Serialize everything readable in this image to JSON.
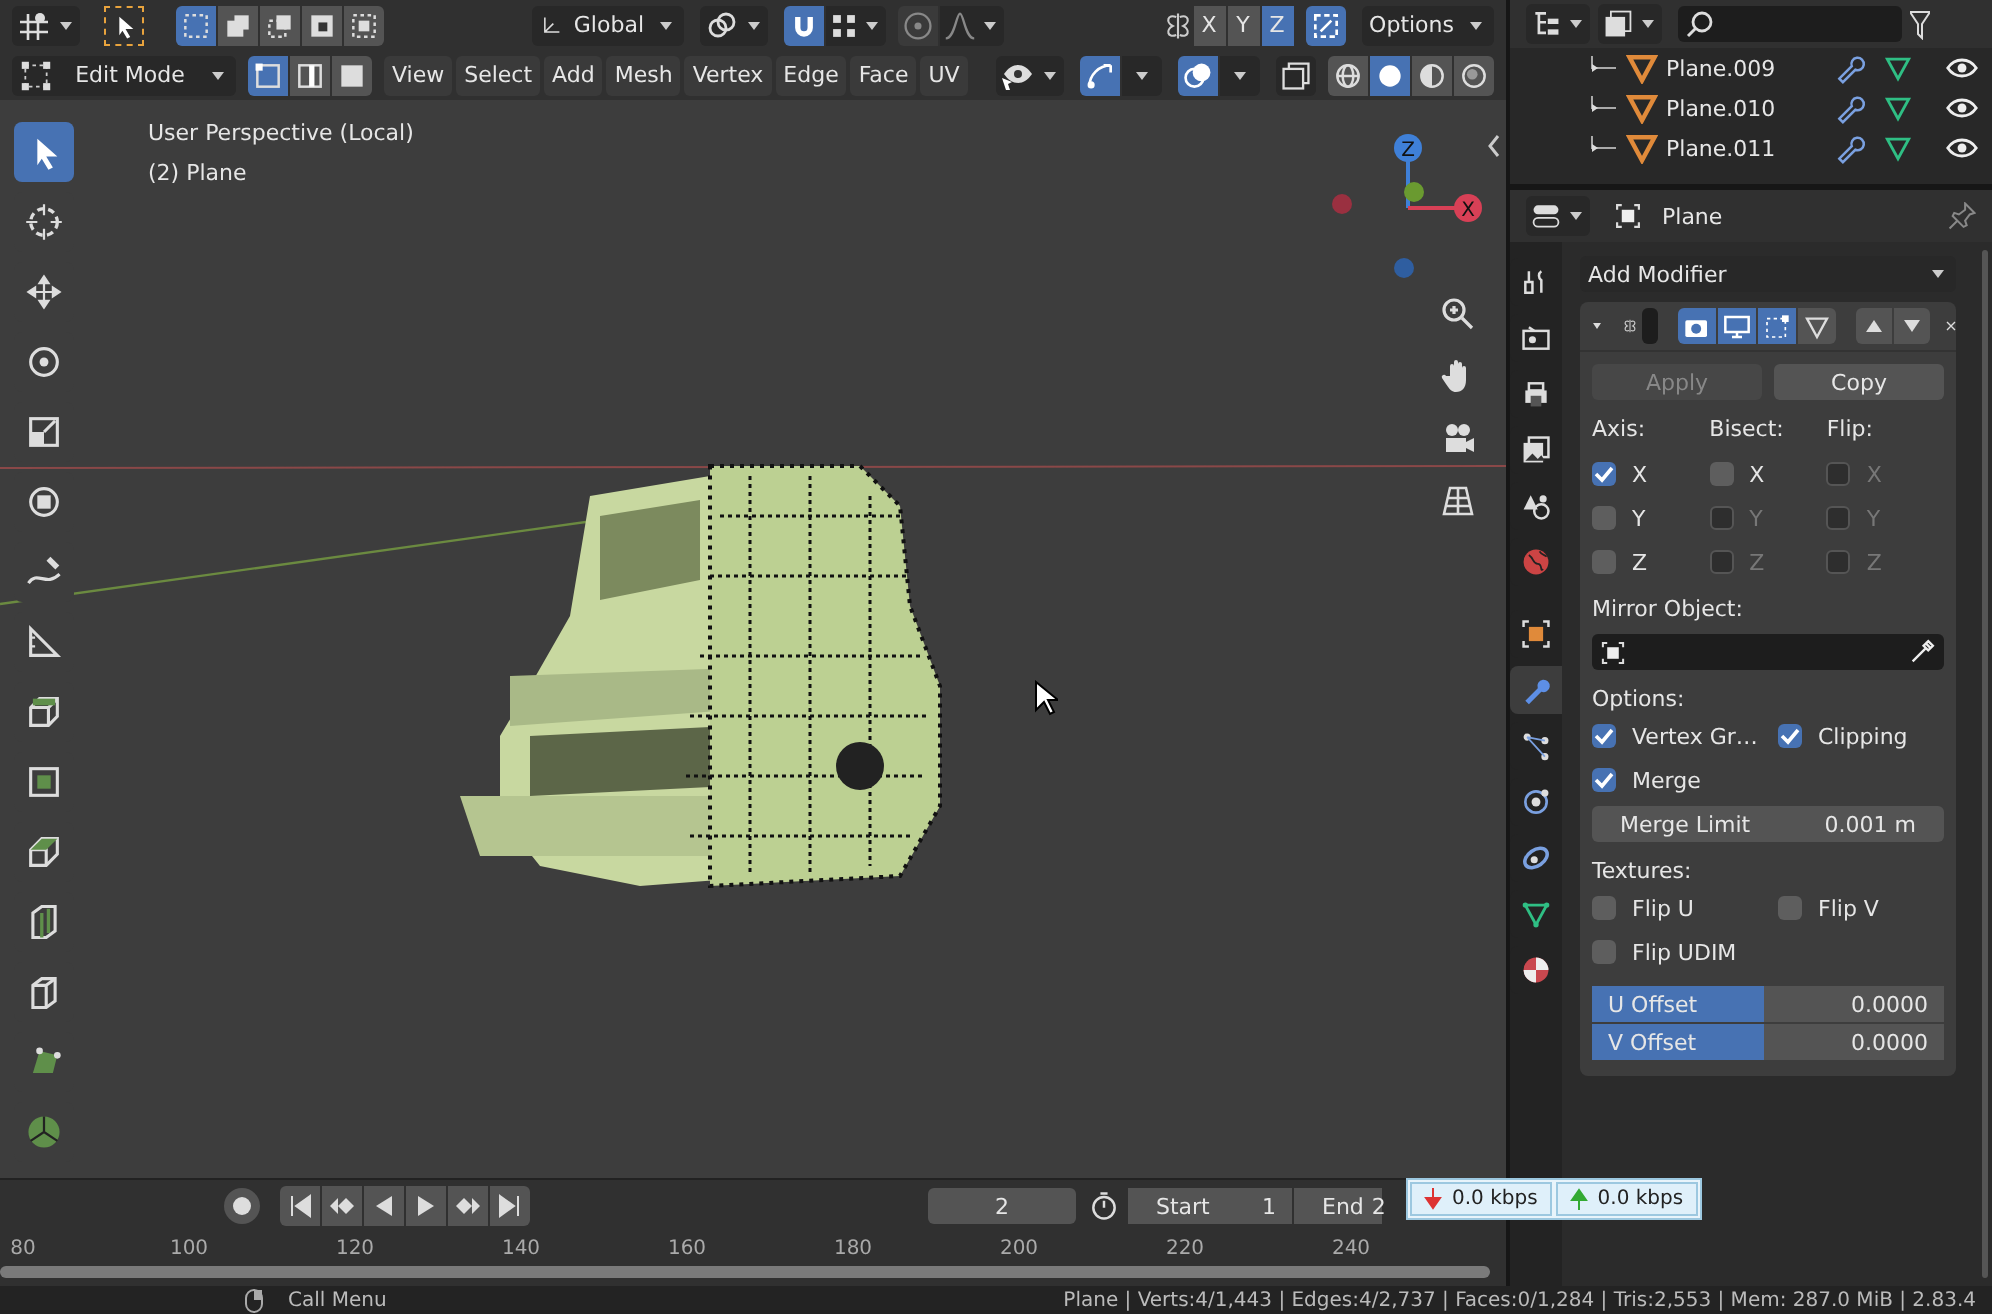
{
  "header": {
    "select_modes": [
      {
        "selected": true
      },
      {
        "selected": false
      },
      {
        "selected": false
      },
      {
        "selected": false
      },
      {
        "selected": false
      }
    ],
    "orientation": "Global",
    "snap_on": true,
    "proportional_on": false,
    "mirror_axes": [
      {
        "label": "X",
        "selected": false
      },
      {
        "label": "Y",
        "selected": false
      },
      {
        "label": "Z",
        "selected": true
      }
    ],
    "gizmo_on": true,
    "options": "Options"
  },
  "mode_bar": {
    "mode": "Edit Mode",
    "element_modes": [
      {
        "selected": true
      },
      {
        "selected": false
      },
      {
        "selected": false
      }
    ],
    "menus": [
      "View",
      "Select",
      "Add",
      "Mesh",
      "Vertex",
      "Edge",
      "Face",
      "UV"
    ],
    "gizmos_on": true,
    "overlays_on": true,
    "xray_on": false,
    "shading": [
      {
        "selected": false
      },
      {
        "selected": true
      },
      {
        "selected": false
      },
      {
        "selected": false
      }
    ]
  },
  "viewport": {
    "view_name": "User Perspective (Local)",
    "object_label": "(2) Plane",
    "gizmo": {
      "z": "Z",
      "x": "X"
    },
    "tools": [
      {
        "selected": true
      },
      {
        "selected": false
      },
      {
        "selected": false
      },
      {
        "selected": false
      },
      {
        "selected": false
      },
      {
        "selected": false
      },
      {
        "selected": false
      },
      {
        "selected": false
      },
      {
        "selected": false
      },
      {
        "selected": false
      },
      {
        "selected": false
      },
      {
        "selected": false
      },
      {
        "selected": false
      },
      {
        "selected": false
      },
      {
        "selected": false
      }
    ]
  },
  "outliner": {
    "items": [
      {
        "name": "Plane.009"
      },
      {
        "name": "Plane.010"
      },
      {
        "name": "Plane.011"
      }
    ]
  },
  "properties": {
    "object_name": "Plane",
    "add_modifier": "Add Modifier",
    "tabs": [
      {
        "selected": false
      },
      {
        "selected": false
      },
      {
        "selected": false
      },
      {
        "selected": false
      },
      {
        "selected": false
      },
      {
        "selected": false
      },
      {
        "selected": false
      },
      {
        "selected": true
      },
      {
        "selected": false
      },
      {
        "selected": false
      },
      {
        "selected": false
      },
      {
        "selected": false
      },
      {
        "selected": false
      }
    ],
    "modifier": {
      "expanded": true,
      "display_toggles": [
        {
          "selected": true
        },
        {
          "selected": true
        },
        {
          "selected": true
        },
        {
          "selected": false
        }
      ]
    },
    "apply": {
      "label": "Apply",
      "disabled": true
    },
    "copy": "Copy",
    "axis_groups": [
      {
        "title": "Axis:",
        "items": [
          {
            "label": "X",
            "checked": true,
            "disabled": false
          },
          {
            "label": "Y",
            "checked": false,
            "disabled": false
          },
          {
            "label": "Z",
            "checked": false,
            "disabled": false
          }
        ]
      },
      {
        "title": "Bisect:",
        "items": [
          {
            "label": "X",
            "checked": false,
            "disabled": false
          },
          {
            "label": "Y",
            "checked": false,
            "disabled": true
          },
          {
            "label": "Z",
            "checked": false,
            "disabled": true
          }
        ]
      },
      {
        "title": "Flip:",
        "items": [
          {
            "label": "X",
            "checked": false,
            "disabled": true
          },
          {
            "label": "Y",
            "checked": false,
            "disabled": true
          },
          {
            "label": "Z",
            "checked": false,
            "disabled": true
          }
        ]
      }
    ],
    "mirror_object": "Mirror Object:",
    "options_title": "Options:",
    "options": [
      {
        "label": "Vertex Gr…",
        "checked": true
      },
      {
        "label": "Clipping",
        "checked": true
      },
      {
        "label": "Merge",
        "checked": true
      }
    ],
    "merge_limit": {
      "label": "Merge Limit",
      "value": "0.001 m"
    },
    "textures_title": "Textures:",
    "textures": [
      {
        "label": "Flip U",
        "checked": false
      },
      {
        "label": "Flip V",
        "checked": false
      },
      {
        "label": "Flip UDIM",
        "checked": false
      }
    ],
    "offsets": [
      {
        "label": "U Offset",
        "value": "0.0000",
        "level": 0.49
      },
      {
        "label": "V Offset",
        "value": "0.0000",
        "level": 0.49
      }
    ]
  },
  "timeline": {
    "current_frame": "2",
    "start_label": "Start",
    "start": "1",
    "end_label": "End",
    "end": "2",
    "ruler": [
      "80",
      "100",
      "120",
      "140",
      "160",
      "180",
      "200",
      "220",
      "240"
    ]
  },
  "network": {
    "down": "0.0 kbps",
    "up": "0.0 kbps"
  },
  "status": {
    "hint": "Call Menu",
    "stats": "Plane | Verts:4/1,443 | Edges:4/2,737 | Faces:0/1,284 | Tris:2,553 | Mem: 287.0 MiB | 2.83.4"
  }
}
